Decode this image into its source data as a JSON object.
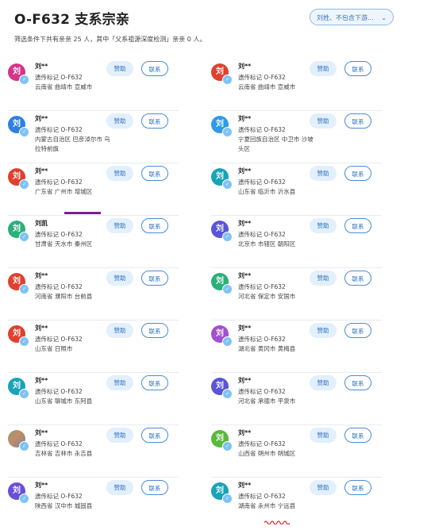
{
  "header": {
    "title": "O-F632 支系宗亲",
    "filter_label": "刘姓、不包含下游...",
    "summary": "筛选条件下共有亲亲 25 人，其中「父系祖源深度检测」亲亲 0 人。"
  },
  "buttons": {
    "sponsor": "赞助",
    "contact": "联系"
  },
  "colors": {
    "accent": "#2a6fc0",
    "badge": "#7fc3f5",
    "annotation": "#7a1f8c"
  },
  "cards": [
    {
      "name": "刘**",
      "avatar_text": "刘",
      "avatar_color": "#d6338a",
      "tag": "遗传标记 O-F632",
      "location": "云南省 曲靖市 宣威市"
    },
    {
      "name": "刘**",
      "avatar_text": "刘",
      "avatar_color": "#e0412f",
      "tag": "遗传标记 O-F632",
      "location": "云南省 曲靖市 宣威市"
    },
    {
      "name": "刘**",
      "avatar_text": "刘",
      "avatar_color": "#2f80e0",
      "tag": "遗传标记 O-F632",
      "location": "内蒙古自治区 巴彦淖尔市 乌拉特前旗"
    },
    {
      "name": "刘**",
      "avatar_text": "刘",
      "avatar_color": "#2f9be8",
      "tag": "遗传标记 O-F632",
      "location": "宁夏回族自治区 中卫市 沙坡头区"
    },
    {
      "name": "刘**",
      "avatar_text": "刘",
      "avatar_color": "#e0412f",
      "tag": "遗传标记 O-F632",
      "location": "广东省 广州市 增城区"
    },
    {
      "name": "刘**",
      "avatar_text": "刘",
      "avatar_color": "#18a3b8",
      "tag": "遗传标记 O-F632",
      "location": "山东省 临沂市 沂水县"
    },
    {
      "name": "刘凯",
      "avatar_text": "刘",
      "avatar_color": "#2bb07a",
      "tag": "遗传标记 O-F632",
      "location": "甘肃省 天水市 秦州区"
    },
    {
      "name": "刘**",
      "avatar_text": "刘",
      "avatar_color": "#5a54d8",
      "tag": "遗传标记 O-F632",
      "location": "北京市 市辖区 朝阳区"
    },
    {
      "name": "刘**",
      "avatar_text": "刘",
      "avatar_color": "#e0412f",
      "tag": "遗传标记 O-F632",
      "location": "河南省 濮阳市 台前县"
    },
    {
      "name": "刘**",
      "avatar_text": "刘",
      "avatar_color": "#2bb07a",
      "tag": "遗传标记 O-F632",
      "location": "河北省 保定市 安国市"
    },
    {
      "name": "刘**",
      "avatar_text": "刘",
      "avatar_color": "#e0412f",
      "tag": "遗传标记 O-F632",
      "location": "山东省 日照市"
    },
    {
      "name": "刘**",
      "avatar_text": "刘",
      "avatar_color": "#a34fd0",
      "tag": "遗传标记 O-F632",
      "location": "湖北省 黄冈市 黄梅县"
    },
    {
      "name": "刘**",
      "avatar_text": "刘",
      "avatar_color": "#18a3b8",
      "tag": "遗传标记 O-F632",
      "location": "山东省 聊城市 东阿县"
    },
    {
      "name": "刘**",
      "avatar_text": "刘",
      "avatar_color": "#5a54d8",
      "tag": "遗传标记 O-F632",
      "location": "河北省 承德市 平泉市"
    },
    {
      "name": "刘**",
      "avatar_text": "",
      "avatar_color": "photo",
      "tag": "遗传标记 O-F632",
      "location": "吉林省 吉林市 永吉县"
    },
    {
      "name": "刘**",
      "avatar_text": "刘",
      "avatar_color": "#58b93a",
      "tag": "遗传标记 O-F632",
      "location": "山西省 朔州市 朔城区"
    },
    {
      "name": "刘**",
      "avatar_text": "刘",
      "avatar_color": "#6a4fd8",
      "tag": "遗传标记 O-F632",
      "location": "陕西省 汉中市 城固县"
    },
    {
      "name": "刘**",
      "avatar_text": "刘",
      "avatar_color": "#18a3b8",
      "tag": "遗传标记 O-F632",
      "location": "湖南省 永州市 宁远县"
    }
  ]
}
